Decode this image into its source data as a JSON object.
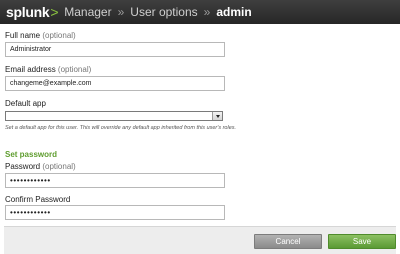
{
  "header": {
    "logo": "splunk",
    "logo_suffix": ">",
    "breadcrumb": [
      "Manager",
      "User options"
    ],
    "separator": "»",
    "current": "admin"
  },
  "form": {
    "full_name": {
      "label": "Full name",
      "optional": "(optional)",
      "value": "Administrator"
    },
    "email": {
      "label": "Email address",
      "optional": "(optional)",
      "value": "changeme@example.com"
    },
    "default_app": {
      "label": "Default app",
      "value": "",
      "help": "Set a default app for this user. This will override any default app inherited from this user's roles."
    },
    "password_section": {
      "title": "Set password",
      "password": {
        "label": "Password",
        "optional": "(optional)",
        "value": "••••••••••••"
      },
      "confirm": {
        "label": "Confirm Password",
        "value": "••••••••••••"
      }
    }
  },
  "footer": {
    "cancel_label": "Cancel",
    "save_label": "Save"
  }
}
